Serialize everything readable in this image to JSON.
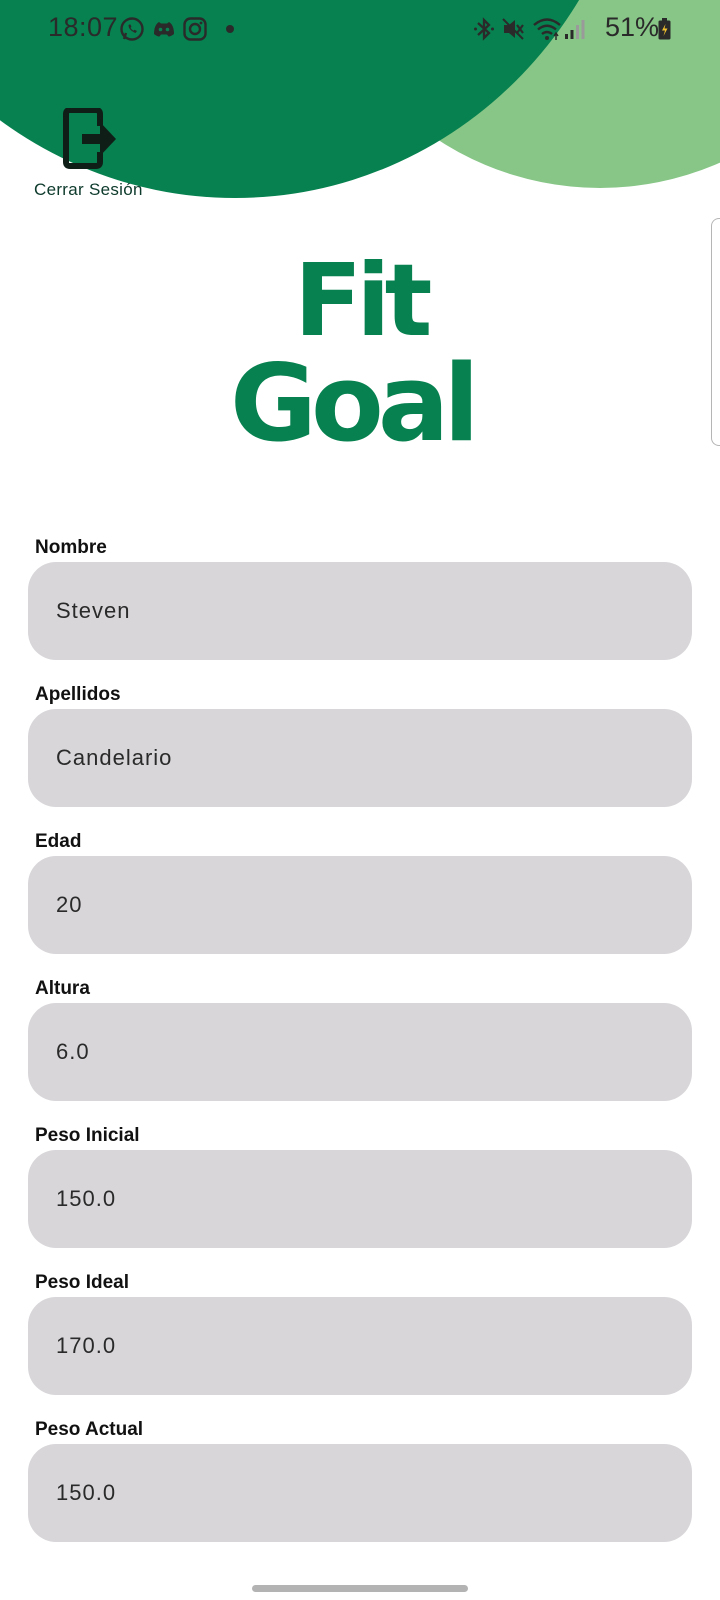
{
  "status_bar": {
    "time": "18:07",
    "left_icons": [
      "whatsapp-icon",
      "discord-icon",
      "instagram-icon",
      "notification-dot"
    ],
    "right_icons": [
      "bluetooth-icon",
      "mute-icon",
      "wifi-icon",
      "signal-icon"
    ],
    "battery": "51%"
  },
  "header": {
    "logout_label": "Cerrar Sesión",
    "logout_icon": "logout-icon"
  },
  "logo": {
    "line1": "Fit",
    "line2": "Goal"
  },
  "form": {
    "fields": [
      {
        "label": "Nombre",
        "value": "Steven"
      },
      {
        "label": "Apellidos",
        "value": "Candelario"
      },
      {
        "label": "Edad",
        "value": "20"
      },
      {
        "label": "Altura",
        "value": "6.0"
      },
      {
        "label": "Peso Inicial",
        "value": "150.0"
      },
      {
        "label": "Peso Ideal",
        "value": "170.0"
      },
      {
        "label": "Peso Actual",
        "value": "150.0"
      }
    ]
  },
  "colors": {
    "brand_green": "#06814f",
    "light_green": "#87c687",
    "input_bg": "#d8d6d9"
  }
}
